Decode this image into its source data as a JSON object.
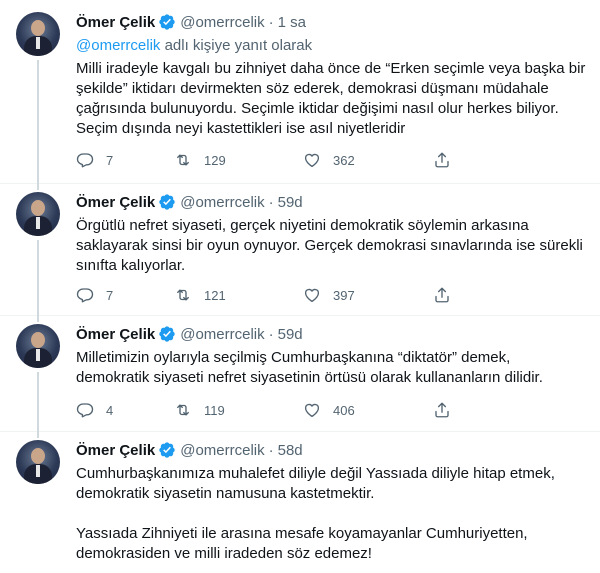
{
  "colors": {
    "accent": "#1d9bf0",
    "secondary_text": "#536471",
    "thread_line": "#cfd9de",
    "border": "#eff3f4"
  },
  "icons": {
    "verified": "verified-badge-icon",
    "reply": "reply-icon",
    "retweet": "retweet-icon",
    "like": "like-icon",
    "share": "share-icon"
  },
  "tweets": [
    {
      "name": "Ömer Çelik",
      "handle": "@omerrcelik",
      "time": "1 sa",
      "replying_to_mention": "@omerrcelik",
      "replying_to_suffix": " adlı kişiye yanıt olarak",
      "paragraphs": [
        "Milli iradeyle kavgalı bu zihniyet daha önce de “Erken seçimle veya başka bir şekilde” iktidarı devirmekten söz ederek, demokrasi düşmanı müdahale çağrısında bulunuyordu. Seçimle iktidar değişimi nasıl olur herkes biliyor. Seçim dışında neyi kastettikleri ise asıl niyetleridir"
      ],
      "replies": "7",
      "retweets": "129",
      "likes": "362"
    },
    {
      "name": "Ömer Çelik",
      "handle": "@omerrcelik",
      "time": "59d",
      "paragraphs": [
        "Örgütlü nefret siyaseti, gerçek niyetini demokratik söylemin arkasına saklayarak sinsi bir oyun oynuyor. Gerçek demokrasi sınavlarında ise sürekli sınıfta kalıyorlar."
      ],
      "replies": "7",
      "retweets": "121",
      "likes": "397"
    },
    {
      "name": "Ömer Çelik",
      "handle": "@omerrcelik",
      "time": "59d",
      "paragraphs": [
        "Milletimizin oylarıyla seçilmiş Cumhurbaşkanına “diktatör” demek, demokratik siyaseti nefret siyasetinin örtüsü olarak kullananların dilidir."
      ],
      "replies": "4",
      "retweets": "119",
      "likes": "406"
    },
    {
      "name": "Ömer Çelik",
      "handle": "@omerrcelik",
      "time": "58d",
      "paragraphs": [
        "Cumhurbaşkanımıza muhalefet diliyle değil Yassıada diliyle hitap etmek, demokratik siyasetin namusuna kastetmektir.",
        "Yassıada Zihniyeti ile arasına mesafe koyamayanlar Cumhuriyetten, demokrasiden ve milli iradeden söz edemez!"
      ]
    }
  ]
}
